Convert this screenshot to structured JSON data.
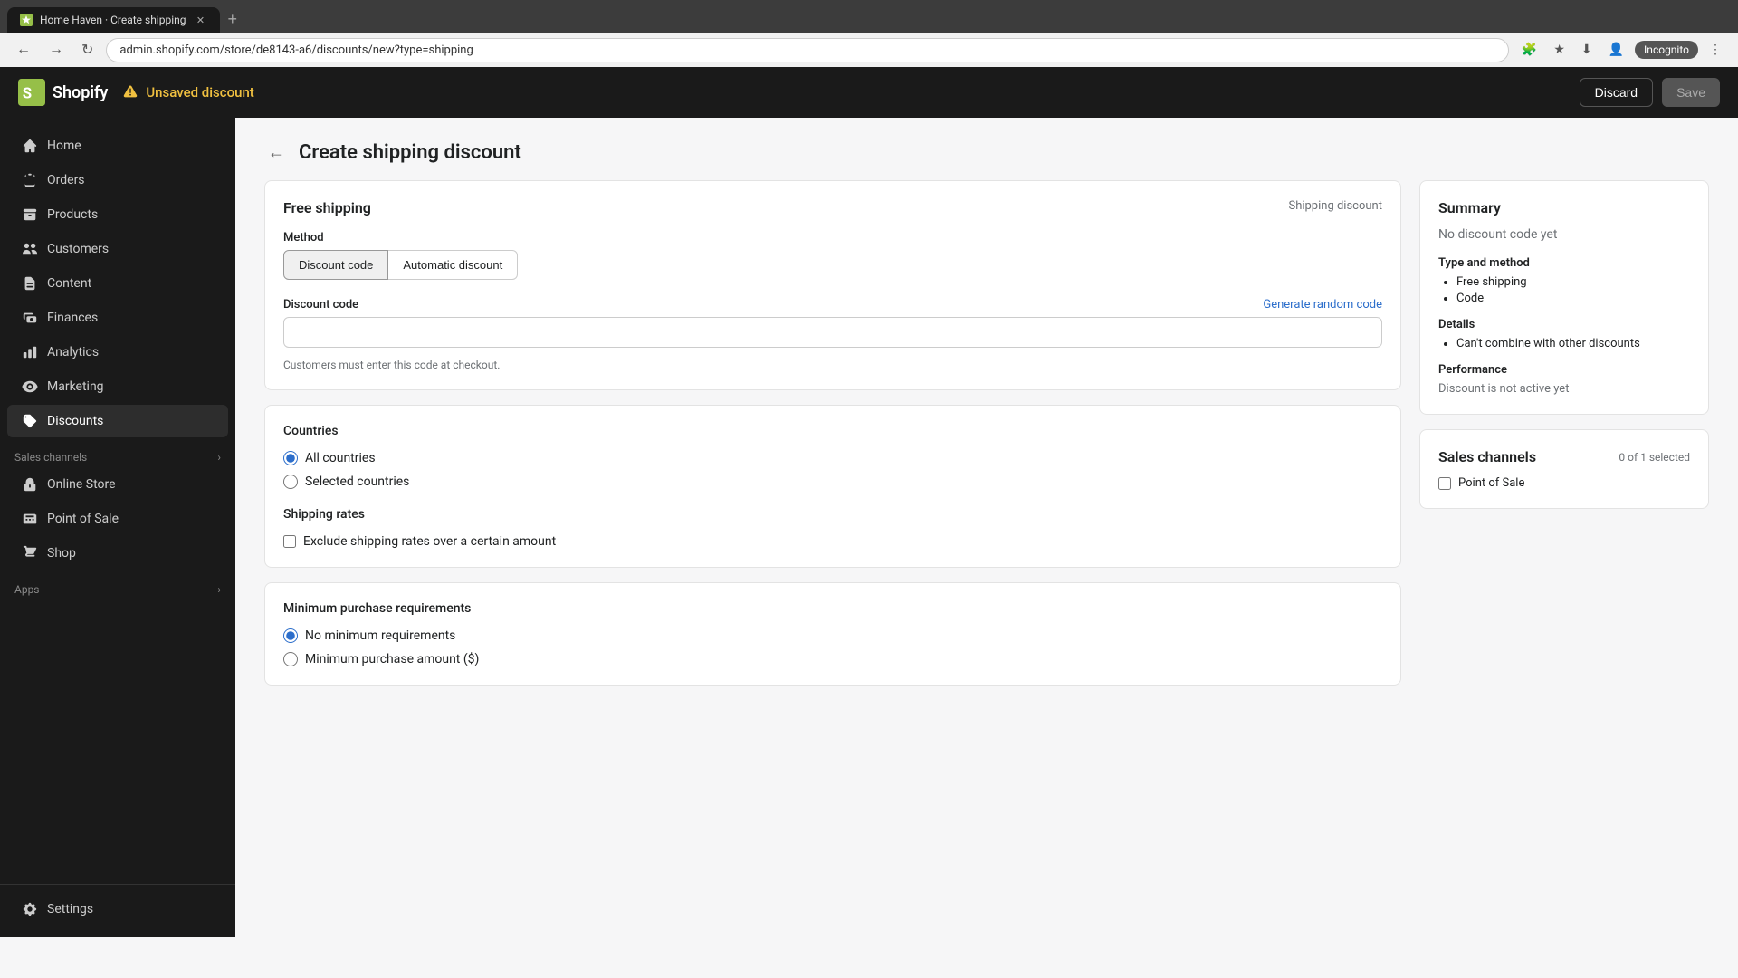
{
  "browser": {
    "tab_title": "Home Haven · Create shipping",
    "address": "admin.shopify.com/store/de8143-a6/discounts/new?type=shipping",
    "incognito": "Incognito"
  },
  "topbar": {
    "logo": "Shopify",
    "unsaved_label": "Unsaved discount",
    "discard_label": "Discard",
    "save_label": "Save"
  },
  "sidebar": {
    "nav_items": [
      {
        "id": "home",
        "label": "Home"
      },
      {
        "id": "orders",
        "label": "Orders"
      },
      {
        "id": "products",
        "label": "Products"
      },
      {
        "id": "customers",
        "label": "Customers"
      },
      {
        "id": "content",
        "label": "Content"
      },
      {
        "id": "finances",
        "label": "Finances"
      },
      {
        "id": "analytics",
        "label": "Analytics"
      },
      {
        "id": "marketing",
        "label": "Marketing"
      },
      {
        "id": "discounts",
        "label": "Discounts"
      }
    ],
    "sales_channels_label": "Sales channels",
    "sales_channel_items": [
      {
        "id": "online-store",
        "label": "Online Store"
      },
      {
        "id": "point-of-sale",
        "label": "Point of Sale"
      },
      {
        "id": "shop",
        "label": "Shop"
      }
    ],
    "apps_label": "Apps",
    "settings_label": "Settings"
  },
  "page": {
    "title": "Create shipping discount",
    "back_label": "←"
  },
  "form": {
    "card_title": "Free shipping",
    "card_subtitle": "Shipping discount",
    "method_label": "Method",
    "method_tabs": [
      {
        "id": "discount-code",
        "label": "Discount code",
        "active": true
      },
      {
        "id": "automatic",
        "label": "Automatic discount",
        "active": false
      }
    ],
    "discount_code_label": "Discount code",
    "generate_link": "Generate random code",
    "discount_code_placeholder": "",
    "discount_code_hint": "Customers must enter this code at checkout.",
    "countries_label": "Countries",
    "countries_options": [
      {
        "id": "all",
        "label": "All countries",
        "checked": true
      },
      {
        "id": "selected",
        "label": "Selected countries",
        "checked": false
      }
    ],
    "shipping_rates_label": "Shipping rates",
    "exclude_rates_label": "Exclude shipping rates over a certain amount",
    "exclude_rates_checked": false,
    "min_purchase_label": "Minimum purchase requirements",
    "min_purchase_options": [
      {
        "id": "no-min",
        "label": "No minimum requirements",
        "checked": true
      },
      {
        "id": "min-amount",
        "label": "Minimum purchase amount ($)",
        "checked": false
      }
    ]
  },
  "summary": {
    "title": "Summary",
    "no_code_text": "No discount code yet",
    "type_method_title": "Type and method",
    "type_method_items": [
      "Free shipping",
      "Code"
    ],
    "details_title": "Details",
    "details_items": [
      "Can't combine with other discounts"
    ],
    "performance_title": "Performance",
    "performance_text": "Discount is not active yet",
    "sales_channels_title": "Sales channels",
    "sales_channels_count": "0 of 1 selected",
    "sales_channel_items": [
      {
        "label": "Point of Sale",
        "checked": false
      }
    ]
  }
}
